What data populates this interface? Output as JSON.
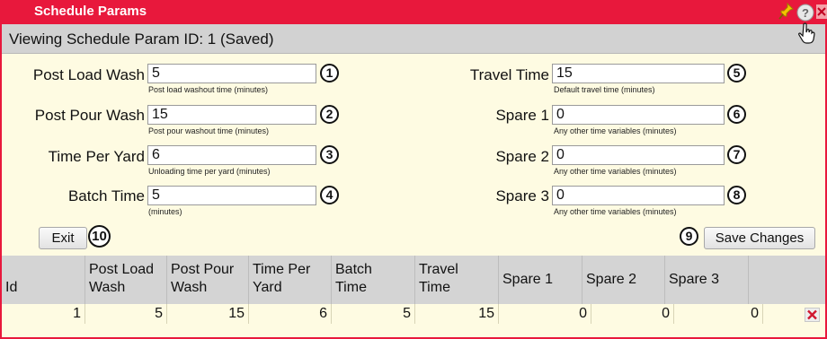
{
  "window": {
    "title": "Schedule Params"
  },
  "subheader": {
    "text": "Viewing Schedule Param ID: 1 (Saved)"
  },
  "fields": [
    {
      "label": "Post Load Wash",
      "value": "5",
      "hint": "Post load washout time (minutes)",
      "marker": "1"
    },
    {
      "label": "Post Pour Wash",
      "value": "15",
      "hint": "Post pour washout time (minutes)",
      "marker": "2"
    },
    {
      "label": "Time Per Yard",
      "value": "6",
      "hint": "Unloading time per yard (minutes)",
      "marker": "3"
    },
    {
      "label": "Batch Time",
      "value": "5",
      "hint": "(minutes)",
      "marker": "4"
    },
    {
      "label": "Travel Time",
      "value": "15",
      "hint": "Default travel time (minutes)",
      "marker": "5"
    },
    {
      "label": "Spare 1",
      "value": "0",
      "hint": "Any other time variables (minutes)",
      "marker": "6"
    },
    {
      "label": "Spare 2",
      "value": "0",
      "hint": "Any other time variables (minutes)",
      "marker": "7"
    },
    {
      "label": "Spare 3",
      "value": "0",
      "hint": "Any other time variables (minutes)",
      "marker": "8"
    }
  ],
  "buttons": {
    "exit": "Exit",
    "exit_marker": "10",
    "save": "Save Changes",
    "save_marker": "9"
  },
  "grid": {
    "headers": [
      [
        "Id"
      ],
      [
        "Post Load",
        "Wash"
      ],
      [
        "Post Pour",
        "Wash"
      ],
      [
        "Time Per",
        "Yard"
      ],
      [
        "Batch",
        "Time"
      ],
      [
        "Travel",
        "Time"
      ],
      [
        "Spare 1"
      ],
      [
        "Spare 2"
      ],
      [
        "Spare 3"
      ]
    ],
    "rows": [
      [
        "1",
        "5",
        "15",
        "6",
        "5",
        "15",
        "0",
        "0",
        "0"
      ]
    ]
  },
  "icons": {
    "pin": "pin-icon",
    "help": "help-icon",
    "close": "close-icon",
    "delete": "delete-row-icon",
    "cursor": "hand-cursor-icon"
  },
  "colors": {
    "accent": "#e8183c",
    "panel": "#fefbe2",
    "header_gray": "#d2d2d2"
  }
}
